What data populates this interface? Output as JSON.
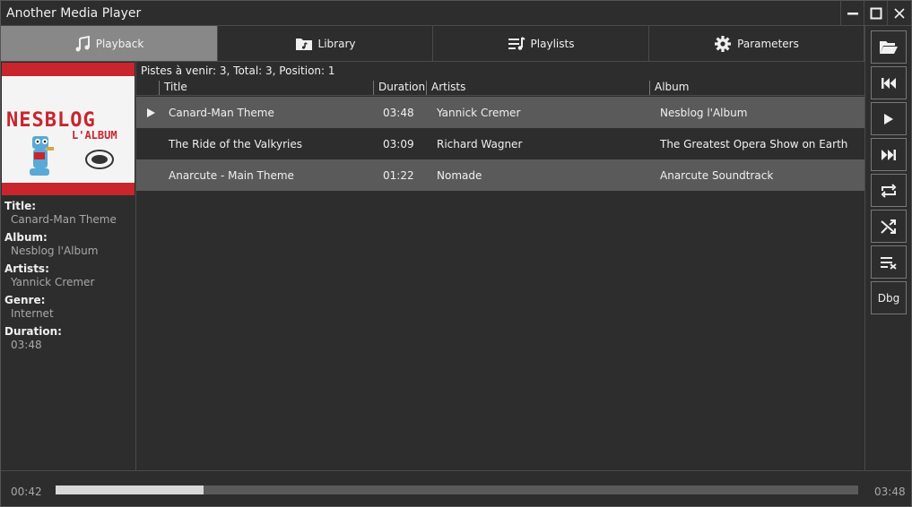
{
  "window": {
    "title": "Another Media Player"
  },
  "tabs": [
    {
      "label": "Playback",
      "icon": "music-note-icon",
      "active": true
    },
    {
      "label": "Library",
      "icon": "music-folder-icon",
      "active": false
    },
    {
      "label": "Playlists",
      "icon": "playlist-icon",
      "active": false
    },
    {
      "label": "Parameters",
      "icon": "gear-icon",
      "active": false
    }
  ],
  "cover": {
    "logo_text": "NESBLOG",
    "sub_text": "L'ALBUM",
    "accent": "#c8252d"
  },
  "info": {
    "title_label": "Title:",
    "title_value": "Canard-Man Theme",
    "album_label": "Album:",
    "album_value": "Nesblog l'Album",
    "artists_label": "Artists:",
    "artists_value": "Yannick Cremer",
    "genre_label": "Genre:",
    "genre_value": "Internet",
    "duration_label": "Duration:",
    "duration_value": "03:48"
  },
  "queue": {
    "status": "Pistes à venir:  3, Total:  3, Position: 1",
    "columns": [
      "Title",
      "Duration",
      "Artists",
      "Album"
    ],
    "rows": [
      {
        "title": "Canard-Man Theme",
        "duration": "03:48",
        "artists": "Yannick Cremer",
        "album": "Nesblog l'Album",
        "playing": true
      },
      {
        "title": "The Ride of the Valkyries",
        "duration": "03:09",
        "artists": "Richard Wagner",
        "album": "The Greatest Opera Show on Earth",
        "playing": false
      },
      {
        "title": "Anarcute - Main Theme",
        "duration": "01:22",
        "artists": "Nomade",
        "album": "Anarcute Soundtrack",
        "playing": false
      }
    ]
  },
  "controls": [
    {
      "name": "open-folder-button",
      "icon": "open-folder-icon"
    },
    {
      "name": "previous-button",
      "icon": "skip-previous-icon"
    },
    {
      "name": "play-button",
      "icon": "play-icon"
    },
    {
      "name": "next-button",
      "icon": "skip-next-icon"
    },
    {
      "name": "repeat-button",
      "icon": "repeat-icon"
    },
    {
      "name": "shuffle-button",
      "icon": "shuffle-icon"
    },
    {
      "name": "clear-queue-button",
      "icon": "clear-list-icon"
    },
    {
      "name": "debug-button",
      "label": "Dbg"
    }
  ],
  "progress": {
    "elapsed": "00:42",
    "total": "03:48",
    "fraction": 0.184
  }
}
